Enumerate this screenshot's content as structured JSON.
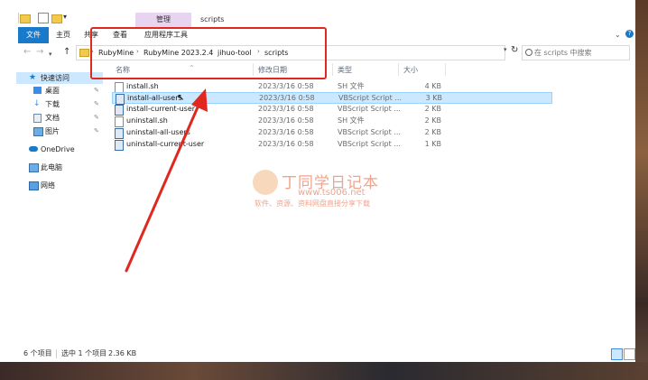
{
  "window": {
    "title": "scripts",
    "manage_tab": "管理"
  },
  "ribbon": {
    "tabs": [
      "文件",
      "主页",
      "共享",
      "查看",
      "应用程序工具"
    ],
    "help": "?"
  },
  "address": {
    "crumbs": [
      "RubyMine",
      "RubyMine 2023.2.4",
      "jihuo-tool",
      "scripts"
    ],
    "search_placeholder": "在 scripts 中搜索"
  },
  "sidebar": {
    "items": [
      {
        "label": "快速访问",
        "icon": "star-icon"
      },
      {
        "label": "桌面",
        "icon": "desktop-icon"
      },
      {
        "label": "下载",
        "icon": "download-icon"
      },
      {
        "label": "文档",
        "icon": "document-icon"
      },
      {
        "label": "图片",
        "icon": "picture-icon"
      },
      {
        "label": "OneDrive",
        "icon": "cloud-icon"
      },
      {
        "label": "此电脑",
        "icon": "computer-icon"
      },
      {
        "label": "网络",
        "icon": "network-icon"
      }
    ]
  },
  "columns": {
    "name": "名称",
    "date": "修改日期",
    "type": "类型",
    "size": "大小"
  },
  "files": [
    {
      "name": "install.sh",
      "date": "2023/3/16 0:58",
      "type": "SH 文件",
      "size": "4 KB",
      "kind": "sh"
    },
    {
      "name": "install-all-users",
      "date": "2023/3/16 0:58",
      "type": "VBScript Script ...",
      "size": "3 KB",
      "kind": "vbs",
      "selected": true
    },
    {
      "name": "install-current-user",
      "date": "2023/3/16 0:58",
      "type": "VBScript Script ...",
      "size": "2 KB",
      "kind": "vbs"
    },
    {
      "name": "uninstall.sh",
      "date": "2023/3/16 0:58",
      "type": "SH 文件",
      "size": "2 KB",
      "kind": "sh"
    },
    {
      "name": "uninstall-all-users",
      "date": "2023/3/16 0:58",
      "type": "VBScript Script ...",
      "size": "2 KB",
      "kind": "vbs"
    },
    {
      "name": "uninstall-current-user",
      "date": "2023/3/16 0:58",
      "type": "VBScript Script ...",
      "size": "1 KB",
      "kind": "vbs"
    }
  ],
  "watermark": {
    "title": "丁同学日记本",
    "url": "www.ts006.net",
    "subtitle": "软件、资源、资料网盘直接分享下载"
  },
  "status": {
    "count": "6 个项目",
    "selected": "选中 1 个项目",
    "size": "2.36 KB"
  },
  "colors": {
    "accent": "#1979ca",
    "annotation": "#e0281e",
    "selection": "#cce8ff"
  }
}
